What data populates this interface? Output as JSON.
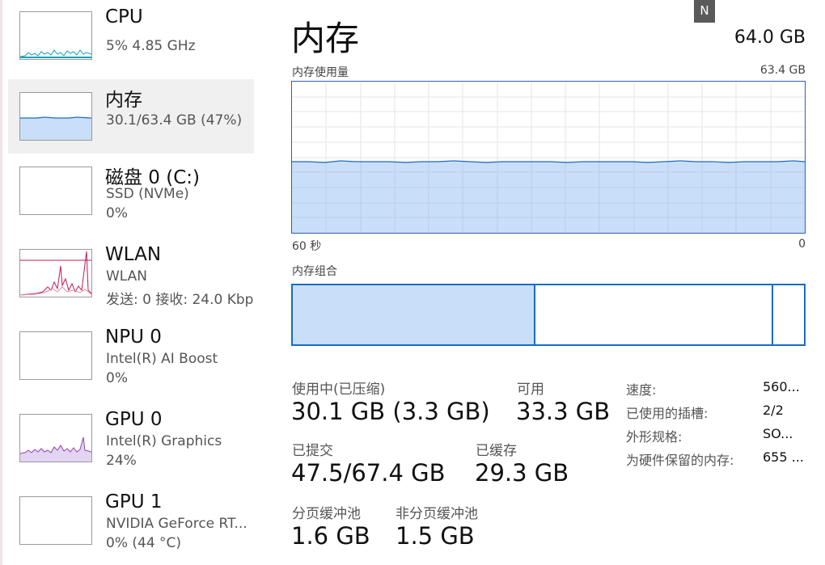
{
  "sidebar": {
    "items": [
      {
        "title": "CPU",
        "line1": "5%  4.85 GHz",
        "line2": "",
        "color": "#17a2b8"
      },
      {
        "title": "内存",
        "line1": "30.1/63.4 GB (47%)",
        "line2": "",
        "color": "#1a6bc4"
      },
      {
        "title": "磁盘 0 (C:)",
        "line1": "SSD (NVMe)",
        "line2": "0%",
        "color": "#4caf50"
      },
      {
        "title": "WLAN",
        "line1": "WLAN",
        "line2": "发送: 0 接收: 24.0 Kbp",
        "color": "#c2185b"
      },
      {
        "title": "NPU 0",
        "line1": "Intel(R) AI Boost",
        "line2": "0%",
        "color": "#1a6bc4"
      },
      {
        "title": "GPU 0",
        "line1": "Intel(R) Graphics",
        "line2": "24%",
        "color": "#8e44ad"
      },
      {
        "title": "GPU 1",
        "line1": "NVIDIA GeForce RT...",
        "line2": "0% (44 °C)",
        "color": "#8e44ad"
      }
    ]
  },
  "main": {
    "title": "内存",
    "total": "64.0 GB",
    "badge": "N",
    "usage_label": "内存使用量",
    "usage_max": "63.4 GB",
    "time_left": "60 秒",
    "time_right": "0",
    "usage_fraction": 0.47,
    "composition_label": "内存组合",
    "composition": {
      "in_use_fraction": 0.475,
      "available_fraction": 0.465,
      "other_fraction": 0.06
    },
    "stats": {
      "in_use_label": "使用中(已压缩)",
      "in_use_value": "30.1 GB (3.3 GB)",
      "available_label": "可用",
      "available_value": "33.3 GB",
      "committed_label": "已提交",
      "committed_value": "47.5/67.4 GB",
      "cached_label": "已缓存",
      "cached_value": "29.3 GB",
      "paged_label": "分页缓冲池",
      "paged_value": "1.6 GB",
      "nonpaged_label": "非分页缓冲池",
      "nonpaged_value": "1.5 GB"
    },
    "details": [
      {
        "label": "速度:",
        "value": "560..."
      },
      {
        "label": "已使用的插槽:",
        "value": "2/2"
      },
      {
        "label": "外形规格:",
        "value": "SO..."
      },
      {
        "label": "为硬件保留的内存:",
        "value": "655 ..."
      }
    ]
  },
  "colors": {
    "accent": "#1a6bc4",
    "fill": "#c9def8",
    "grid": "#e6e6e6"
  }
}
